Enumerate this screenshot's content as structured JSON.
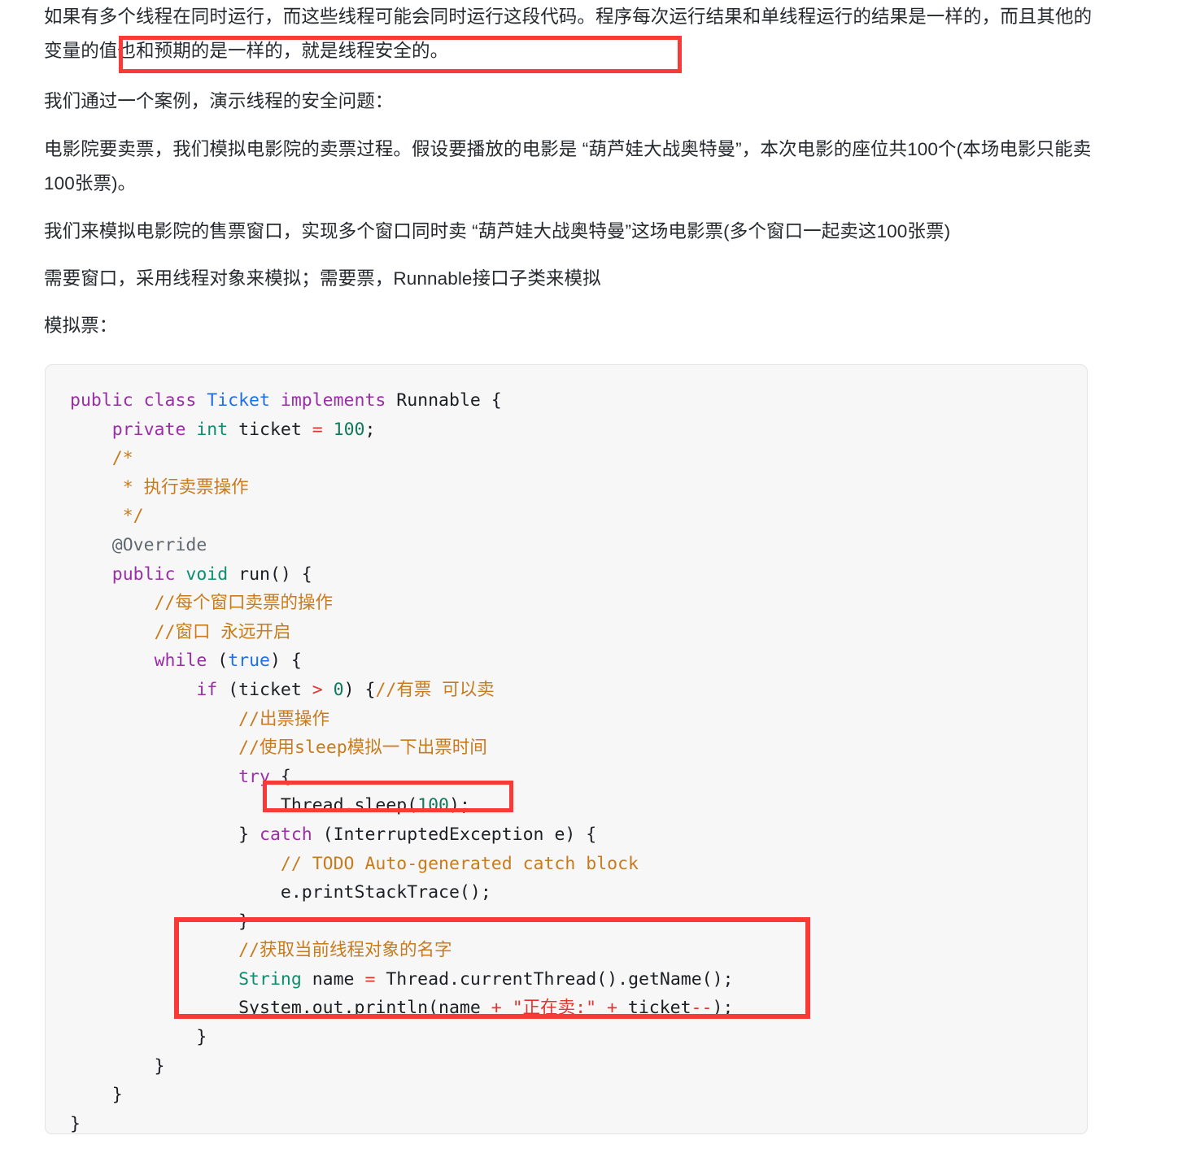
{
  "document": {
    "paragraphs": {
      "intro": "如果有多个线程在同时运行，而这些线程可能会同时运行这段代码。程序每次运行结果和单线程运行的结果是一样的，而且其他的变量的值也和预期的是一样的，就是线程安全的。",
      "case": "我们通过一个案例，演示线程的安全问题：",
      "cinema": "电影院要卖票，我们模拟电影院的卖票过程。假设要播放的电影是 “葫芦娃大战奥特曼”，本次电影的座位共100个(本场电影只能卖100张票)。",
      "windows": "我们来模拟电影院的售票窗口，实现多个窗口同时卖 “葫芦娃大战奥特曼”这场电影票(多个窗口一起卖这100张票)",
      "runnable": "需要窗口，采用线程对象来模拟；需要票，Runnable接口子类来模拟",
      "mock_ticket": "模拟票："
    },
    "annotations": {
      "highlight_color": "#f93a36",
      "inline_highlight_text": "其他的变量的值也和预期的是一样的，就是线程安全的。",
      "sleep_highlight_text": "Thread.sleep(100);",
      "block_highlight_text": "//获取当前线程对象的名字 String name = Thread.currentThread().getName(); System.out.println(name + \"正在卖:\" + ticket--);"
    },
    "code": {
      "language": "java",
      "background": "#f7f7f7",
      "lines": [
        {
          "id": "l1",
          "tokens": [
            {
              "t": "public ",
              "c": "kw"
            },
            {
              "t": "class ",
              "c": "kw"
            },
            {
              "t": "Ticket ",
              "c": "cls"
            },
            {
              "t": "implements ",
              "c": "kw"
            },
            {
              "t": "Runnable {",
              "c": "pln"
            }
          ]
        },
        {
          "id": "l2",
          "tokens": [
            {
              "t": "    ",
              "c": "pln"
            },
            {
              "t": "private ",
              "c": "kw"
            },
            {
              "t": "int ",
              "c": "typ"
            },
            {
              "t": "ticket ",
              "c": "pln"
            },
            {
              "t": "=",
              "c": "op"
            },
            {
              "t": " ",
              "c": "pln"
            },
            {
              "t": "100",
              "c": "num"
            },
            {
              "t": ";",
              "c": "pln"
            }
          ]
        },
        {
          "id": "l3",
          "tokens": [
            {
              "t": "    /*",
              "c": "cmt"
            }
          ]
        },
        {
          "id": "l4",
          "tokens": [
            {
              "t": "     * 执行卖票操作",
              "c": "cmt"
            }
          ]
        },
        {
          "id": "l5",
          "tokens": [
            {
              "t": "     */",
              "c": "cmt"
            }
          ]
        },
        {
          "id": "l6",
          "tokens": [
            {
              "t": "    ",
              "c": "pln"
            },
            {
              "t": "@Override",
              "c": "ann"
            }
          ]
        },
        {
          "id": "l7",
          "tokens": [
            {
              "t": "    ",
              "c": "pln"
            },
            {
              "t": "public ",
              "c": "kw"
            },
            {
              "t": "void ",
              "c": "typ"
            },
            {
              "t": "run",
              "c": "pln"
            },
            {
              "t": "() {",
              "c": "pln"
            }
          ]
        },
        {
          "id": "l8",
          "tokens": [
            {
              "t": "        ",
              "c": "pln"
            },
            {
              "t": "//每个窗口卖票的操作",
              "c": "cmt"
            }
          ]
        },
        {
          "id": "l9",
          "tokens": [
            {
              "t": "        ",
              "c": "pln"
            },
            {
              "t": "//窗口 永远开启",
              "c": "cmt"
            }
          ]
        },
        {
          "id": "l10",
          "tokens": [
            {
              "t": "        ",
              "c": "pln"
            },
            {
              "t": "while ",
              "c": "kw"
            },
            {
              "t": "(",
              "c": "pln"
            },
            {
              "t": "true",
              "c": "lit"
            },
            {
              "t": ") {",
              "c": "pln"
            }
          ]
        },
        {
          "id": "l11",
          "tokens": [
            {
              "t": "            ",
              "c": "pln"
            },
            {
              "t": "if ",
              "c": "kw"
            },
            {
              "t": "(ticket ",
              "c": "pln"
            },
            {
              "t": ">",
              "c": "op"
            },
            {
              "t": " ",
              "c": "pln"
            },
            {
              "t": "0",
              "c": "num"
            },
            {
              "t": ") {",
              "c": "pln"
            },
            {
              "t": "//有票 可以卖",
              "c": "cmt"
            }
          ]
        },
        {
          "id": "l12",
          "tokens": [
            {
              "t": "                ",
              "c": "pln"
            },
            {
              "t": "//出票操作",
              "c": "cmt"
            }
          ]
        },
        {
          "id": "l13",
          "tokens": [
            {
              "t": "                ",
              "c": "pln"
            },
            {
              "t": "//使用sleep模拟一下出票时间",
              "c": "cmt"
            }
          ]
        },
        {
          "id": "l14",
          "tokens": [
            {
              "t": "                ",
              "c": "pln"
            },
            {
              "t": "try ",
              "c": "kw"
            },
            {
              "t": "{",
              "c": "pln"
            }
          ]
        },
        {
          "id": "l15",
          "tokens": [
            {
              "t": "                    Thread.sleep(",
              "c": "pln"
            },
            {
              "t": "100",
              "c": "num"
            },
            {
              "t": ");",
              "c": "pln"
            }
          ]
        },
        {
          "id": "l16",
          "tokens": [
            {
              "t": "                } ",
              "c": "pln"
            },
            {
              "t": "catch ",
              "c": "kw"
            },
            {
              "t": "(InterruptedException e) {",
              "c": "pln"
            }
          ]
        },
        {
          "id": "l17",
          "tokens": [
            {
              "t": "                    ",
              "c": "pln"
            },
            {
              "t": "// TODO Auto-generated catch block",
              "c": "cmt"
            }
          ]
        },
        {
          "id": "l18",
          "tokens": [
            {
              "t": "                    e.printStackTrace();",
              "c": "pln"
            }
          ]
        },
        {
          "id": "l19",
          "tokens": [
            {
              "t": "                }",
              "c": "pln"
            }
          ]
        },
        {
          "id": "l20",
          "tokens": [
            {
              "t": "                ",
              "c": "pln"
            },
            {
              "t": "//获取当前线程对象的名字",
              "c": "cmt"
            }
          ]
        },
        {
          "id": "l21",
          "tokens": [
            {
              "t": "                ",
              "c": "pln"
            },
            {
              "t": "String ",
              "c": "typ"
            },
            {
              "t": "name ",
              "c": "pln"
            },
            {
              "t": "=",
              "c": "op"
            },
            {
              "t": " Thread.currentThread().getName();",
              "c": "pln"
            }
          ]
        },
        {
          "id": "l22",
          "tokens": [
            {
              "t": "                ",
              "c": "pln"
            },
            {
              "t": "System.out.println(name ",
              "c": "pln"
            },
            {
              "t": "+",
              "c": "op"
            },
            {
              "t": " ",
              "c": "pln"
            },
            {
              "t": "\"正在卖:\"",
              "c": "str"
            },
            {
              "t": " ",
              "c": "pln"
            },
            {
              "t": "+",
              "c": "op"
            },
            {
              "t": " ticket",
              "c": "pln"
            },
            {
              "t": "--",
              "c": "op"
            },
            {
              "t": ");",
              "c": "pln"
            }
          ]
        },
        {
          "id": "l23",
          "tokens": [
            {
              "t": "            }",
              "c": "pln"
            }
          ]
        },
        {
          "id": "l24",
          "tokens": [
            {
              "t": "        }",
              "c": "pln"
            }
          ]
        },
        {
          "id": "l25",
          "tokens": [
            {
              "t": "    }",
              "c": "pln"
            }
          ]
        },
        {
          "id": "l26",
          "tokens": [
            {
              "t": "}",
              "c": "pln"
            }
          ]
        }
      ]
    }
  }
}
